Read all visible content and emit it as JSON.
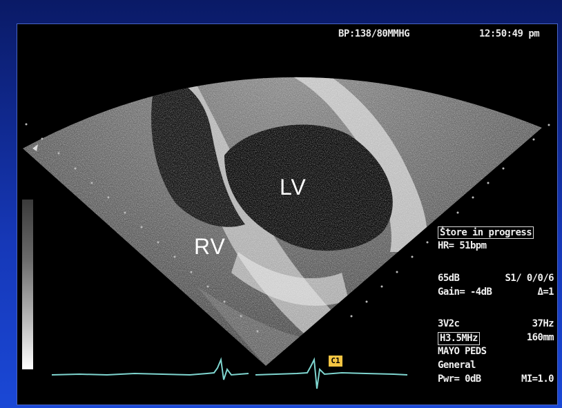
{
  "header": {
    "bp": "BP:138/80MMHG",
    "time": "12:50:49 pm"
  },
  "labels": {
    "lv": "LV",
    "rv": "RV"
  },
  "info_panel": {
    "store": "Store in progress",
    "hr": "HR= 51bpm",
    "db_line_left": "65dB",
    "db_line_right": "S1/ 0/0/6",
    "gain_left": "Gain= -4dB",
    "gain_right": "Δ=1",
    "probe_left": "3V2c",
    "probe_right": "37Hz",
    "freq_left": "H3.5MHz",
    "freq_right": "160mm",
    "institution": "MAYO PEDS",
    "preset": "General",
    "pwr_left": "Pwr= 0dB",
    "pwr_right": "MI=1.0"
  },
  "ecg_marker": "C1",
  "colors": {
    "ecg_trace": "#7fd6d0",
    "marker": "#f5c542",
    "background": "#1638b8"
  }
}
